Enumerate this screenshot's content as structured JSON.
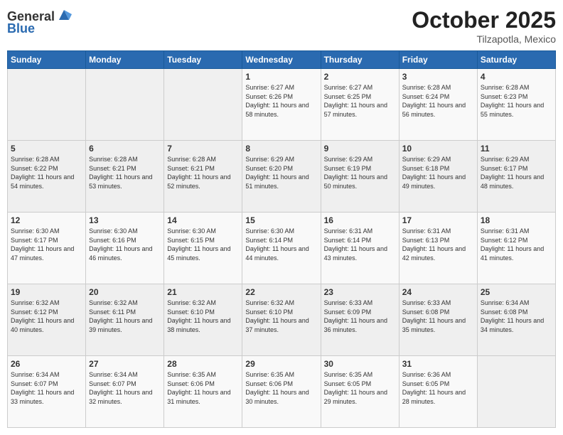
{
  "header": {
    "logo_general": "General",
    "logo_blue": "Blue",
    "month": "October 2025",
    "location": "Tilzapotla, Mexico"
  },
  "days_of_week": [
    "Sunday",
    "Monday",
    "Tuesday",
    "Wednesday",
    "Thursday",
    "Friday",
    "Saturday"
  ],
  "weeks": [
    [
      {
        "day": "",
        "sunrise": "",
        "sunset": "",
        "daylight": ""
      },
      {
        "day": "",
        "sunrise": "",
        "sunset": "",
        "daylight": ""
      },
      {
        "day": "",
        "sunrise": "",
        "sunset": "",
        "daylight": ""
      },
      {
        "day": "1",
        "sunrise": "6:27 AM",
        "sunset": "6:26 PM",
        "daylight": "11 hours and 58 minutes."
      },
      {
        "day": "2",
        "sunrise": "6:27 AM",
        "sunset": "6:25 PM",
        "daylight": "11 hours and 57 minutes."
      },
      {
        "day": "3",
        "sunrise": "6:28 AM",
        "sunset": "6:24 PM",
        "daylight": "11 hours and 56 minutes."
      },
      {
        "day": "4",
        "sunrise": "6:28 AM",
        "sunset": "6:23 PM",
        "daylight": "11 hours and 55 minutes."
      }
    ],
    [
      {
        "day": "5",
        "sunrise": "6:28 AM",
        "sunset": "6:22 PM",
        "daylight": "11 hours and 54 minutes."
      },
      {
        "day": "6",
        "sunrise": "6:28 AM",
        "sunset": "6:21 PM",
        "daylight": "11 hours and 53 minutes."
      },
      {
        "day": "7",
        "sunrise": "6:28 AM",
        "sunset": "6:21 PM",
        "daylight": "11 hours and 52 minutes."
      },
      {
        "day": "8",
        "sunrise": "6:29 AM",
        "sunset": "6:20 PM",
        "daylight": "11 hours and 51 minutes."
      },
      {
        "day": "9",
        "sunrise": "6:29 AM",
        "sunset": "6:19 PM",
        "daylight": "11 hours and 50 minutes."
      },
      {
        "day": "10",
        "sunrise": "6:29 AM",
        "sunset": "6:18 PM",
        "daylight": "11 hours and 49 minutes."
      },
      {
        "day": "11",
        "sunrise": "6:29 AM",
        "sunset": "6:17 PM",
        "daylight": "11 hours and 48 minutes."
      }
    ],
    [
      {
        "day": "12",
        "sunrise": "6:30 AM",
        "sunset": "6:17 PM",
        "daylight": "11 hours and 47 minutes."
      },
      {
        "day": "13",
        "sunrise": "6:30 AM",
        "sunset": "6:16 PM",
        "daylight": "11 hours and 46 minutes."
      },
      {
        "day": "14",
        "sunrise": "6:30 AM",
        "sunset": "6:15 PM",
        "daylight": "11 hours and 45 minutes."
      },
      {
        "day": "15",
        "sunrise": "6:30 AM",
        "sunset": "6:14 PM",
        "daylight": "11 hours and 44 minutes."
      },
      {
        "day": "16",
        "sunrise": "6:31 AM",
        "sunset": "6:14 PM",
        "daylight": "11 hours and 43 minutes."
      },
      {
        "day": "17",
        "sunrise": "6:31 AM",
        "sunset": "6:13 PM",
        "daylight": "11 hours and 42 minutes."
      },
      {
        "day": "18",
        "sunrise": "6:31 AM",
        "sunset": "6:12 PM",
        "daylight": "11 hours and 41 minutes."
      }
    ],
    [
      {
        "day": "19",
        "sunrise": "6:32 AM",
        "sunset": "6:12 PM",
        "daylight": "11 hours and 40 minutes."
      },
      {
        "day": "20",
        "sunrise": "6:32 AM",
        "sunset": "6:11 PM",
        "daylight": "11 hours and 39 minutes."
      },
      {
        "day": "21",
        "sunrise": "6:32 AM",
        "sunset": "6:10 PM",
        "daylight": "11 hours and 38 minutes."
      },
      {
        "day": "22",
        "sunrise": "6:32 AM",
        "sunset": "6:10 PM",
        "daylight": "11 hours and 37 minutes."
      },
      {
        "day": "23",
        "sunrise": "6:33 AM",
        "sunset": "6:09 PM",
        "daylight": "11 hours and 36 minutes."
      },
      {
        "day": "24",
        "sunrise": "6:33 AM",
        "sunset": "6:08 PM",
        "daylight": "11 hours and 35 minutes."
      },
      {
        "day": "25",
        "sunrise": "6:34 AM",
        "sunset": "6:08 PM",
        "daylight": "11 hours and 34 minutes."
      }
    ],
    [
      {
        "day": "26",
        "sunrise": "6:34 AM",
        "sunset": "6:07 PM",
        "daylight": "11 hours and 33 minutes."
      },
      {
        "day": "27",
        "sunrise": "6:34 AM",
        "sunset": "6:07 PM",
        "daylight": "11 hours and 32 minutes."
      },
      {
        "day": "28",
        "sunrise": "6:35 AM",
        "sunset": "6:06 PM",
        "daylight": "11 hours and 31 minutes."
      },
      {
        "day": "29",
        "sunrise": "6:35 AM",
        "sunset": "6:06 PM",
        "daylight": "11 hours and 30 minutes."
      },
      {
        "day": "30",
        "sunrise": "6:35 AM",
        "sunset": "6:05 PM",
        "daylight": "11 hours and 29 minutes."
      },
      {
        "day": "31",
        "sunrise": "6:36 AM",
        "sunset": "6:05 PM",
        "daylight": "11 hours and 28 minutes."
      },
      {
        "day": "",
        "sunrise": "",
        "sunset": "",
        "daylight": ""
      }
    ]
  ],
  "labels": {
    "sunrise": "Sunrise:",
    "sunset": "Sunset:",
    "daylight": "Daylight:"
  }
}
